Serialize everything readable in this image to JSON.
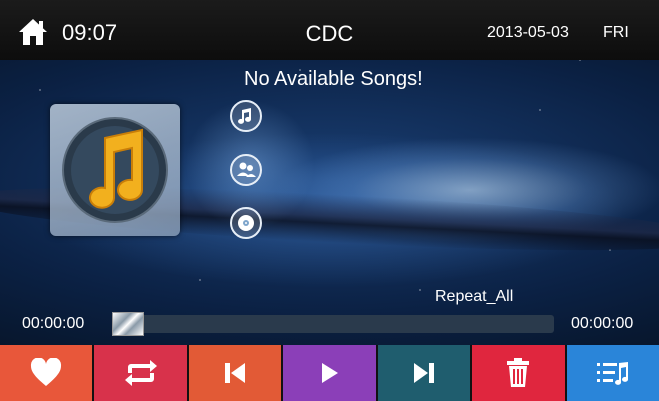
{
  "status_bar": {
    "time": "09:07",
    "title": "CDC",
    "date": "2013-05-03",
    "day": "FRI"
  },
  "player": {
    "message": "No Available Songs!",
    "repeat_mode": "Repeat_All",
    "elapsed": "00:00:00",
    "total": "00:00:00",
    "progress_fraction": 0
  },
  "source_buttons": [
    "music-note-icon",
    "people-icon",
    "disc-icon"
  ],
  "controls": [
    {
      "name": "favorite-button",
      "icon": "heart-icon",
      "color": "#e8573a"
    },
    {
      "name": "repeat-button",
      "icon": "repeat-icon",
      "color": "#d8324b"
    },
    {
      "name": "previous-button",
      "icon": "skip-previous-icon",
      "color": "#e25a36"
    },
    {
      "name": "play-button",
      "icon": "play-icon",
      "color": "#8b3fb8"
    },
    {
      "name": "next-button",
      "icon": "skip-next-icon",
      "color": "#1f5d6e"
    },
    {
      "name": "delete-button",
      "icon": "trash-icon",
      "color": "#e0263e"
    },
    {
      "name": "playlist-button",
      "icon": "playlist-icon",
      "color": "#2a85d9"
    }
  ]
}
